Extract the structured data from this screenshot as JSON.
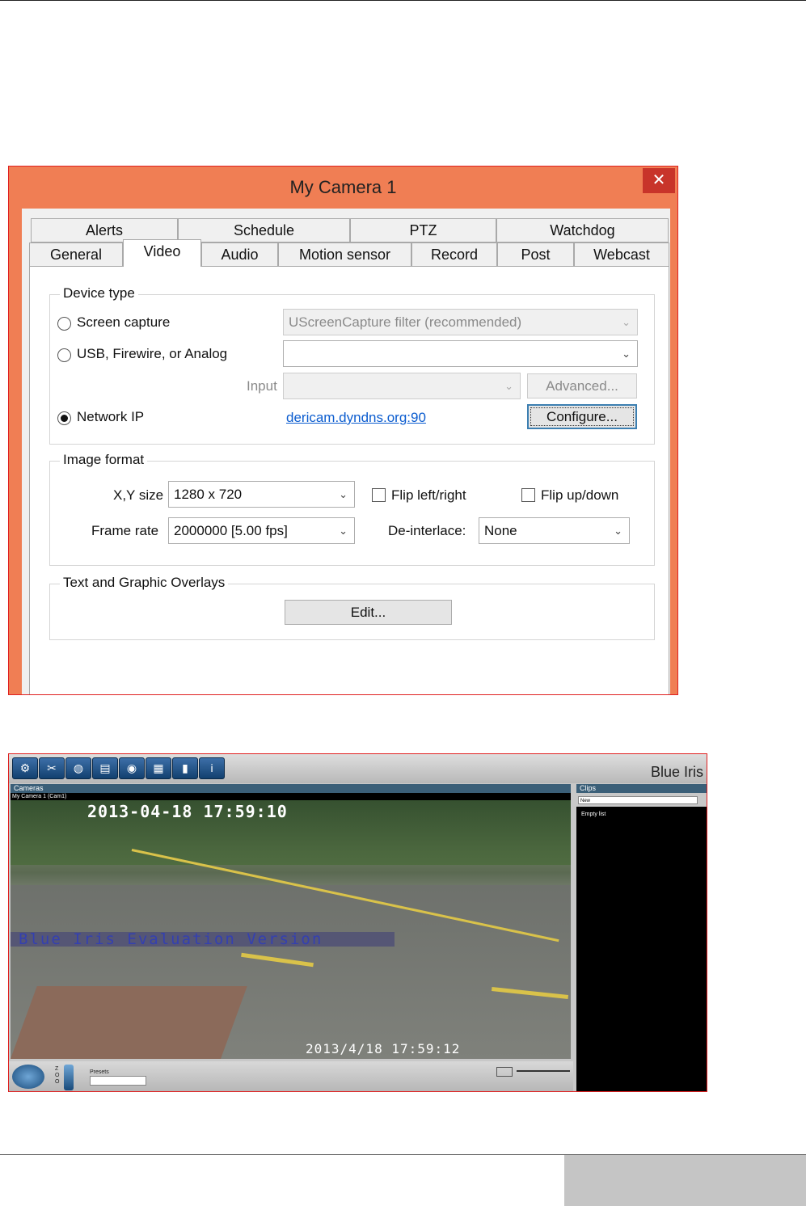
{
  "dialog": {
    "title": "My Camera 1",
    "close_glyph": "✕",
    "tabs_row1": [
      "Alerts",
      "Schedule",
      "PTZ",
      "Watchdog"
    ],
    "tabs_row2": [
      "General",
      "Video",
      "Audio",
      "Motion sensor",
      "Record",
      "Post",
      "Webcast"
    ],
    "active_tab": "Video",
    "device_type": {
      "legend": "Device type",
      "screen_capture_label": "Screen capture",
      "screen_capture_value": "UScreenCapture filter (recommended)",
      "usb_label": "USB, Firewire, or Analog",
      "usb_value": "",
      "input_label": "Input",
      "input_value": "",
      "advanced_label": "Advanced...",
      "network_ip_label": "Network IP",
      "network_ip_link": "dericam.dyndns.org:90",
      "configure_label": "Configure...",
      "selected": "Network IP"
    },
    "image_format": {
      "legend": "Image format",
      "xy_label": "X,Y size",
      "xy_value": "1280 x 720",
      "flip_lr_label": "Flip left/right",
      "flip_ud_label": "Flip up/down",
      "frame_rate_label": "Frame rate",
      "frame_rate_value": "2000000 [5.00 fps]",
      "deinterlace_label": "De-interlace:",
      "deinterlace_value": "None"
    },
    "overlays": {
      "legend": "Text and Graphic Overlays",
      "edit_label": "Edit..."
    }
  },
  "blue_iris": {
    "logo": "Blue Iris",
    "toolbar_icons": [
      "gear-icon",
      "tools-icon",
      "globe-icon",
      "stats-icon",
      "camera-icon",
      "film-icon",
      "traffic-light-icon",
      "info-icon"
    ],
    "cameras_header": "Cameras",
    "camera_label": "My Camera 1 (Cam1)",
    "timestamp_top": "2013-04-18 17:59:10",
    "timestamp_bottom": "2013/4/18 17:59:12",
    "watermark": "Blue Iris Evaluation Version",
    "presets_label": "Presets",
    "clips_header": "Clips",
    "clips_filter": "New",
    "clips_empty": "Empty list"
  }
}
